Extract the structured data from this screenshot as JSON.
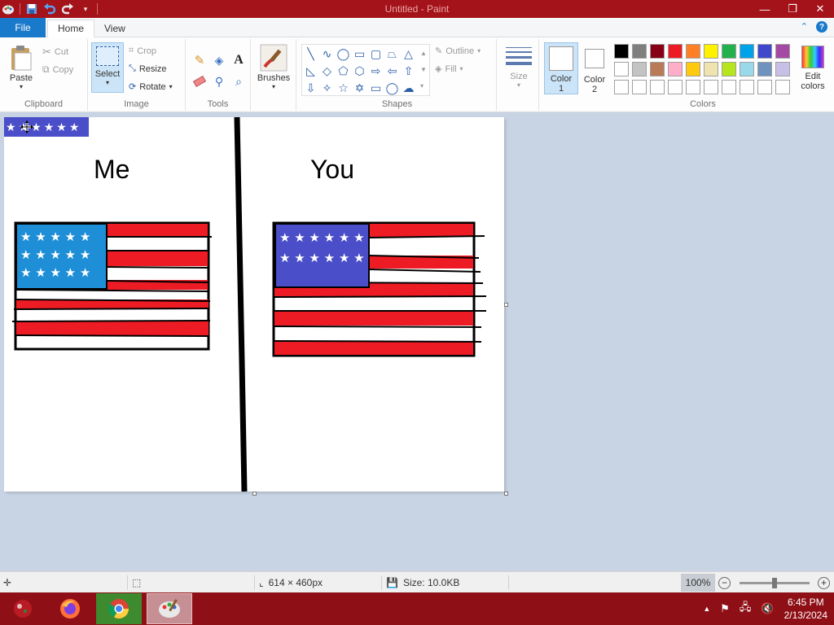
{
  "window": {
    "title": "Untitled - Paint",
    "minimize": "—",
    "maximize": "❐",
    "close": "✕"
  },
  "tabs": {
    "file": "File",
    "home": "Home",
    "view": "View"
  },
  "ribbon": {
    "clipboard": {
      "label": "Clipboard",
      "paste": "Paste",
      "cut": "Cut",
      "copy": "Copy"
    },
    "image": {
      "label": "Image",
      "select": "Select",
      "crop": "Crop",
      "resize": "Resize",
      "rotate": "Rotate"
    },
    "tools": {
      "label": "Tools"
    },
    "brushes": {
      "label": "Brushes"
    },
    "shapes": {
      "label": "Shapes",
      "outline": "Outline",
      "fill": "Fill"
    },
    "size": {
      "label": "Size"
    },
    "color1": {
      "label": "Color",
      "num": "1"
    },
    "color2": {
      "label": "Color",
      "num": "2"
    },
    "colors": {
      "label": "Colors"
    },
    "edit_colors": {
      "line1": "Edit",
      "line2": "colors"
    }
  },
  "palette": [
    "#000000",
    "#7f7f7f",
    "#880015",
    "#ed1c24",
    "#ff7f27",
    "#fff200",
    "#22b14c",
    "#00a2e8",
    "#3f48cc",
    "#a349a4",
    "#ffffff",
    "#c3c3c3",
    "#b97a57",
    "#ffaec9",
    "#ffc90e",
    "#efe4b0",
    "#b5e61d",
    "#99d9ea",
    "#7092be",
    "#c8bfe7",
    "#ffffff",
    "#ffffff",
    "#ffffff",
    "#ffffff",
    "#ffffff",
    "#ffffff",
    "#ffffff",
    "#ffffff",
    "#ffffff",
    "#ffffff"
  ],
  "drawing": {
    "left_label": "Me",
    "right_label": "You"
  },
  "status": {
    "dimensions": "614 × 460px",
    "size": "Size: 10.0KB",
    "zoom": "100%",
    "zoom_level_pct": 50
  },
  "taskbar": {
    "time": "6:45 PM",
    "date": "2/13/2024"
  }
}
